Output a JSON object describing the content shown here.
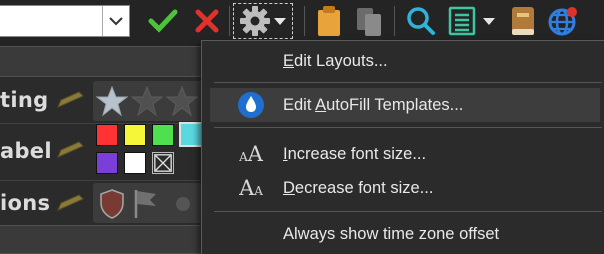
{
  "toolbar": {
    "combo_value": "",
    "icons": [
      "chevron-down-icon",
      "checkmark-icon",
      "close-icon",
      "gear-icon",
      "clipboard-icon",
      "copy-icon",
      "search-icon",
      "list-icon",
      "book-icon",
      "globe-icon"
    ]
  },
  "fields": [
    {
      "label": "ting",
      "picker": "rating"
    },
    {
      "label": "abel",
      "picker": "color"
    },
    {
      "label": "ions",
      "picker": "icons"
    }
  ],
  "colors": {
    "swatches_row1": [
      "#ff3333",
      "#f5f53a",
      "#4ee04e",
      "#5ad8e0"
    ],
    "swatches_row2": [
      "#7a3fd8",
      "#ffffff"
    ]
  },
  "menu": {
    "items": [
      {
        "label": "Edit Layouts...",
        "underline": "E",
        "rest": "dit Layouts..."
      },
      {
        "label_pre": "Edit ",
        "underline": "A",
        "label_post": "utoFill Templates...",
        "highlighted": true
      },
      {
        "underline": "I",
        "rest": "ncrease font size..."
      },
      {
        "underline": "D",
        "rest": "ecrease font size..."
      },
      {
        "label": "Always show time zone offset"
      }
    ],
    "increase_icon_text": {
      "small": "A",
      "big": "A"
    },
    "decrease_icon_text": {
      "big": "A",
      "small": "A"
    }
  }
}
